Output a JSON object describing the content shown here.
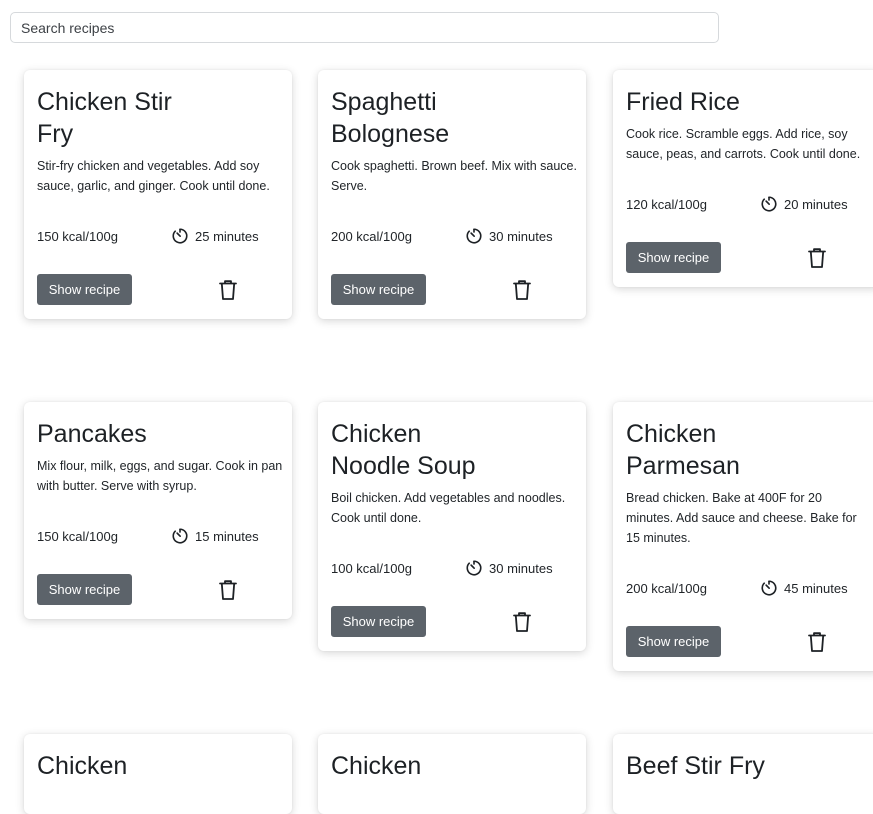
{
  "search": {
    "placeholder": "Search recipes"
  },
  "cards": [
    {
      "title": "Chicken Stir Fry",
      "description": "Stir-fry chicken and vegetables. Add soy sauce, garlic, and ginger. Cook until done.",
      "kcal": "150 kcal/100g",
      "time": "25 minutes",
      "button": "Show recipe"
    },
    {
      "title": "Spaghetti Bolognese",
      "description": "Cook spaghetti. Brown beef. Mix with sauce. Serve.",
      "kcal": "200 kcal/100g",
      "time": "30 minutes",
      "button": "Show recipe"
    },
    {
      "title": "Fried Rice",
      "description": "Cook rice. Scramble eggs. Add rice, soy sauce, peas, and carrots. Cook until done.",
      "kcal": "120 kcal/100g",
      "time": "20 minutes",
      "button": "Show recipe"
    },
    {
      "title": "Pancakes",
      "description": "Mix flour, milk, eggs, and sugar. Cook in pan with butter. Serve with syrup.",
      "kcal": "150 kcal/100g",
      "time": "15 minutes",
      "button": "Show recipe"
    },
    {
      "title": "Chicken Noodle Soup",
      "description": "Boil chicken. Add vegetables and noodles. Cook until done.",
      "kcal": "100 kcal/100g",
      "time": "30 minutes",
      "button": "Show recipe"
    },
    {
      "title": "Chicken Parmesan",
      "description": "Bread chicken. Bake at 400F for 20 minutes. Add sauce and cheese. Bake for 15 minutes.",
      "kcal": "200 kcal/100g",
      "time": "45 minutes",
      "button": "Show recipe"
    },
    {
      "title": "Chicken"
    },
    {
      "title": "Chicken"
    },
    {
      "title": "Beef Stir Fry"
    }
  ]
}
